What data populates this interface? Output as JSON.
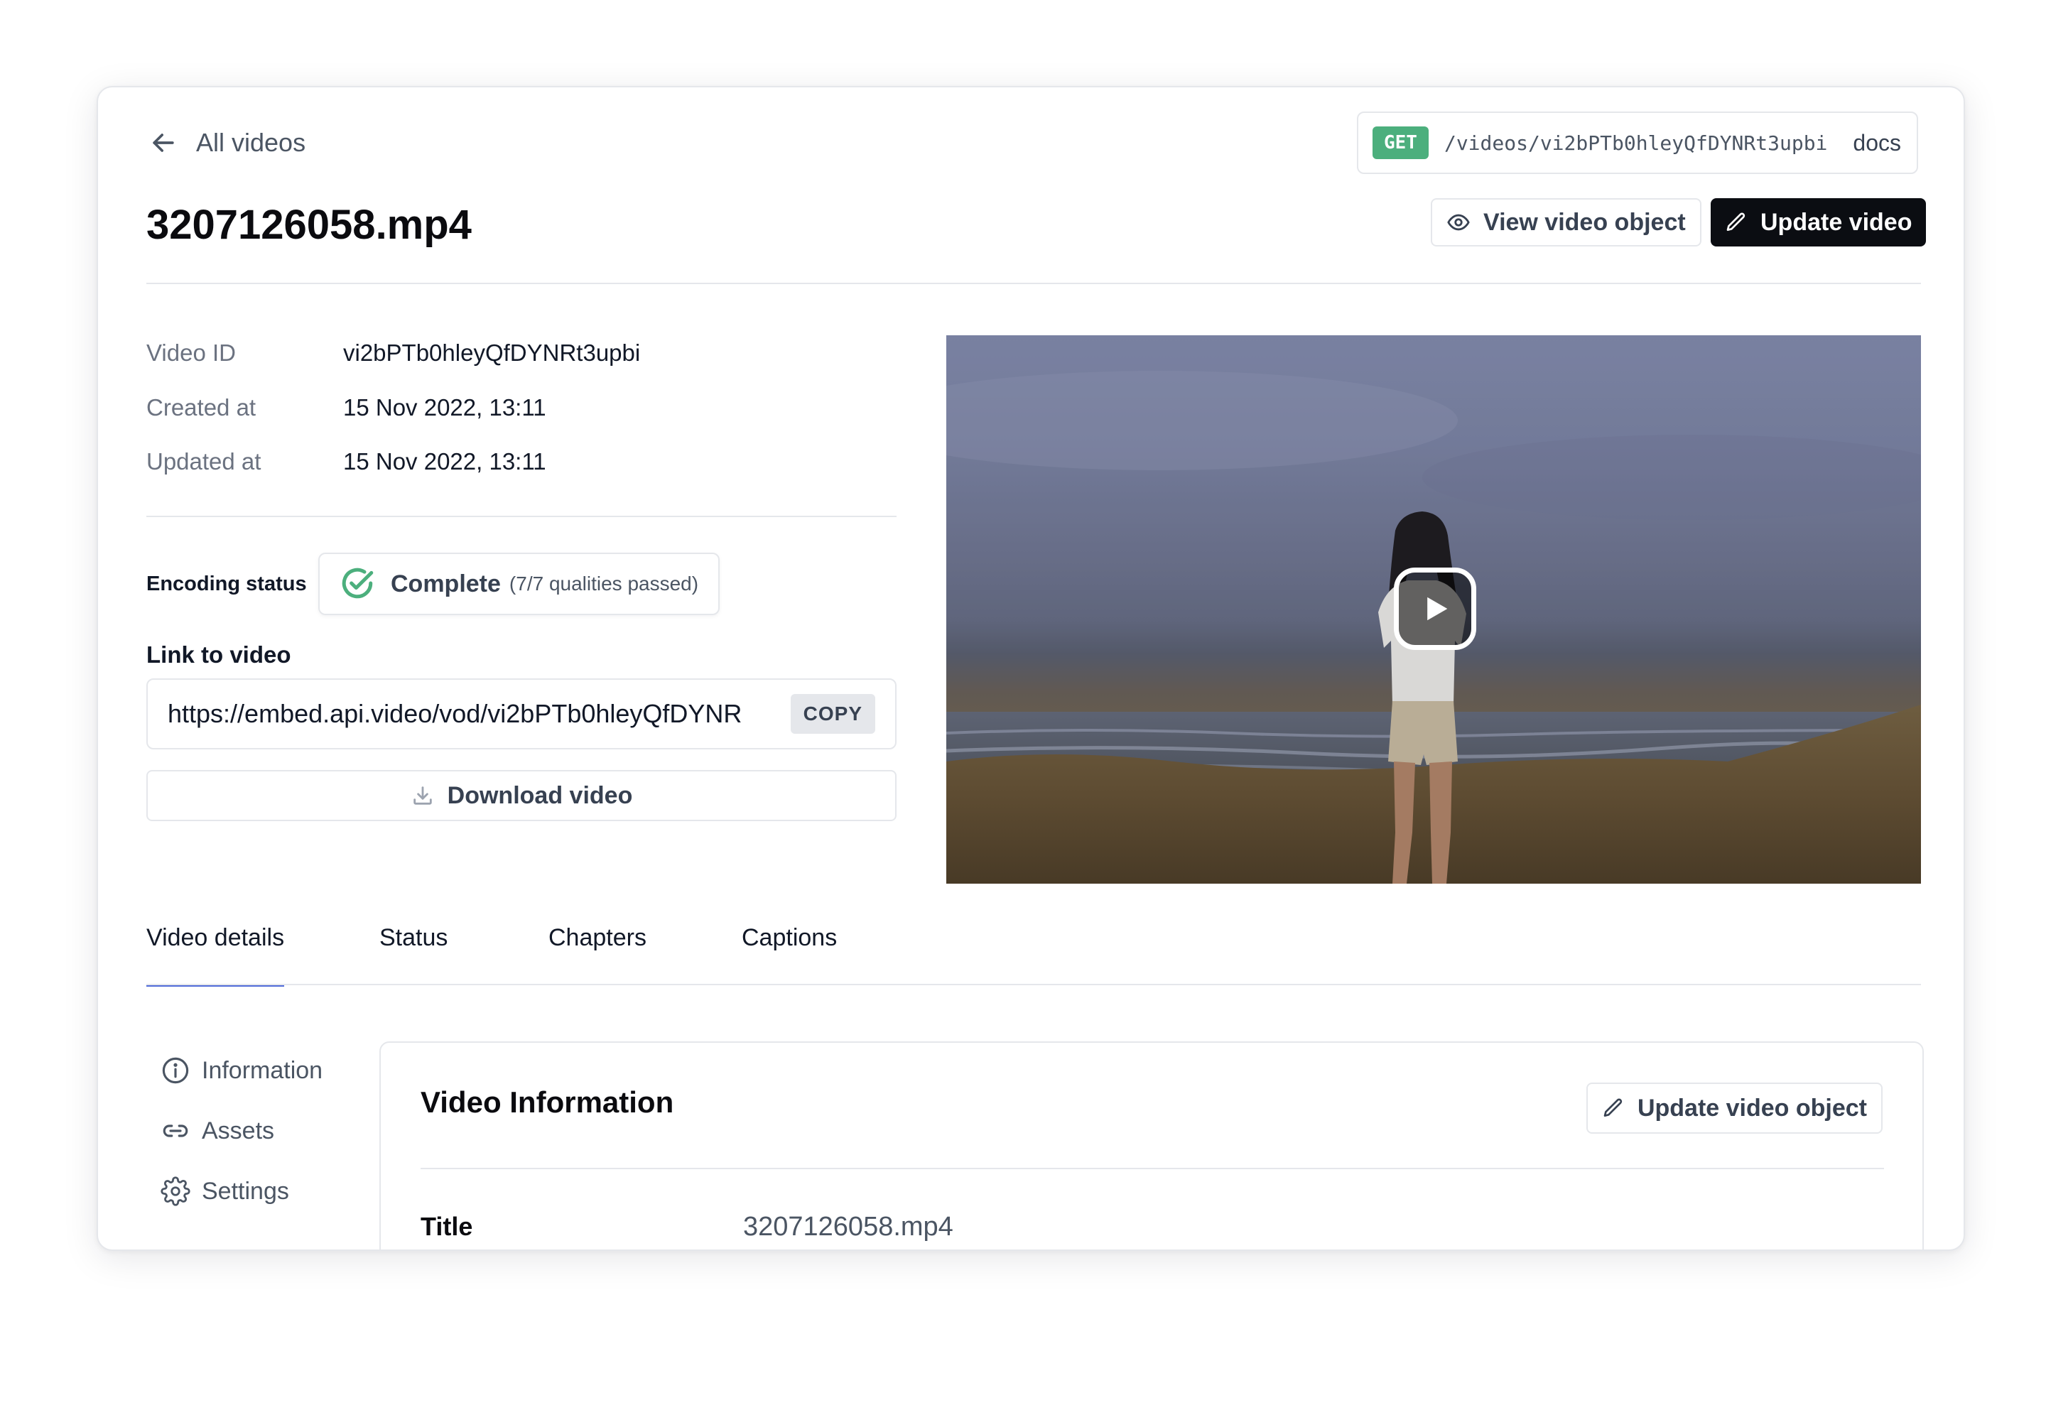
{
  "header": {
    "back_label": "All videos",
    "endpoint_method": "GET",
    "endpoint_path": "/videos/vi2bPTb0hleyQfDYNRt3upbi",
    "docs_label": "docs",
    "title": "3207126058.mp4",
    "view_object_label": "View video object",
    "update_label": "Update video"
  },
  "meta": [
    {
      "label": "Video ID",
      "value": "vi2bPTb0hleyQfDYNRt3upbi"
    },
    {
      "label": "Created at",
      "value": "15 Nov 2022, 13:11"
    },
    {
      "label": "Updated at",
      "value": "15 Nov 2022, 13:11"
    }
  ],
  "encoding": {
    "label": "Encoding status",
    "status": "Complete",
    "detail": "(7/7 qualities passed)",
    "status_color": "#4caf7d"
  },
  "link": {
    "label": "Link to video",
    "url": "https://embed.api.video/vod/vi2bPTb0hleyQfDYNR",
    "copy_label": "COPY",
    "download_label": "Download video"
  },
  "tabs": [
    {
      "label": "Video details",
      "active": true
    },
    {
      "label": "Status",
      "active": false
    },
    {
      "label": "Chapters",
      "active": false
    },
    {
      "label": "Captions",
      "active": false
    }
  ],
  "sidebar": {
    "items": [
      {
        "label": "Information",
        "icon": "info-icon"
      },
      {
        "label": "Assets",
        "icon": "link-icon"
      },
      {
        "label": "Settings",
        "icon": "gear-icon"
      }
    ]
  },
  "info_panel": {
    "title": "Video Information",
    "update_object_label": "Update video object",
    "rows": [
      {
        "label": "Title",
        "value": "3207126058.mp4"
      }
    ]
  },
  "colors": {
    "accent_tab": "#4f6ad8",
    "primary_button": "#0b0d12",
    "get_badge": "#4caf7d"
  }
}
